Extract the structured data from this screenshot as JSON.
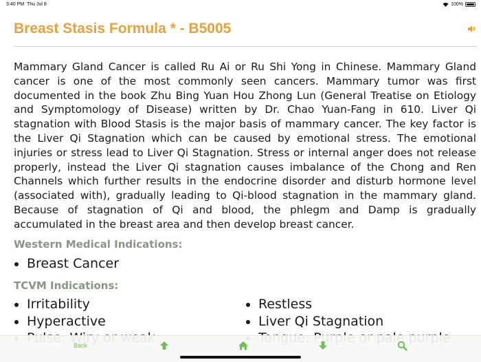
{
  "status_bar": {
    "time": "3:40 PM",
    "date": "Thu Jul 8",
    "battery": "100%"
  },
  "header": {
    "title": "Breast Stasis Formula * - B5005",
    "title_color": "#e8a23c",
    "speaker_icon": "speaker-icon"
  },
  "description": "Mammary Gland Cancer is called Ru Ai or Ru Shi Yong in Chinese. Mammary Gland cancer is one of the most commonly seen cancers. Mammary tumor was first documented in the book Zhu Bing Yuan Hou Zhong Lun (General Treatise on Etiology and Symptomology of Disease) written by Dr. Chao Yuan-Fang in 610. Liver Qi stagnation with Blood Stasis is the major basis of mammary cancer. The key factor is the Liver Qi Stagnation which can be caused by emotional stress. The emotional injuries or stress lead to Liver Qi Stagnation. Stress or internal anger does not release properly, instead the Liver Qi stagnation causes imbalance of the Chong and Ren Channels which further results in the endocrine disorder and disturb hormone level (associated with), gradually leading to Qi-blood stagnation in the mammary gland. Because of stagnation of Qi and blood, the phlegm and Damp is gradually accumulated in the breast area and then develop breast cancer.",
  "western": {
    "heading": "Western Medical Indications:",
    "items": [
      "Breast Cancer"
    ]
  },
  "tcvm": {
    "heading": "TCVM Indications:",
    "left_items": [
      "Irritability",
      "Hyperactive",
      "Pulse: Wiry or weak"
    ],
    "right_items": [
      "Restless",
      "Liver Qi Stagnation",
      "Tongue: Purple or pale purple"
    ]
  },
  "toolbar": {
    "back_label": "Back",
    "accent": "#6fbe5a",
    "icons": [
      "arrow-up-icon",
      "home-icon",
      "arrow-down-icon",
      "search-icon"
    ]
  }
}
